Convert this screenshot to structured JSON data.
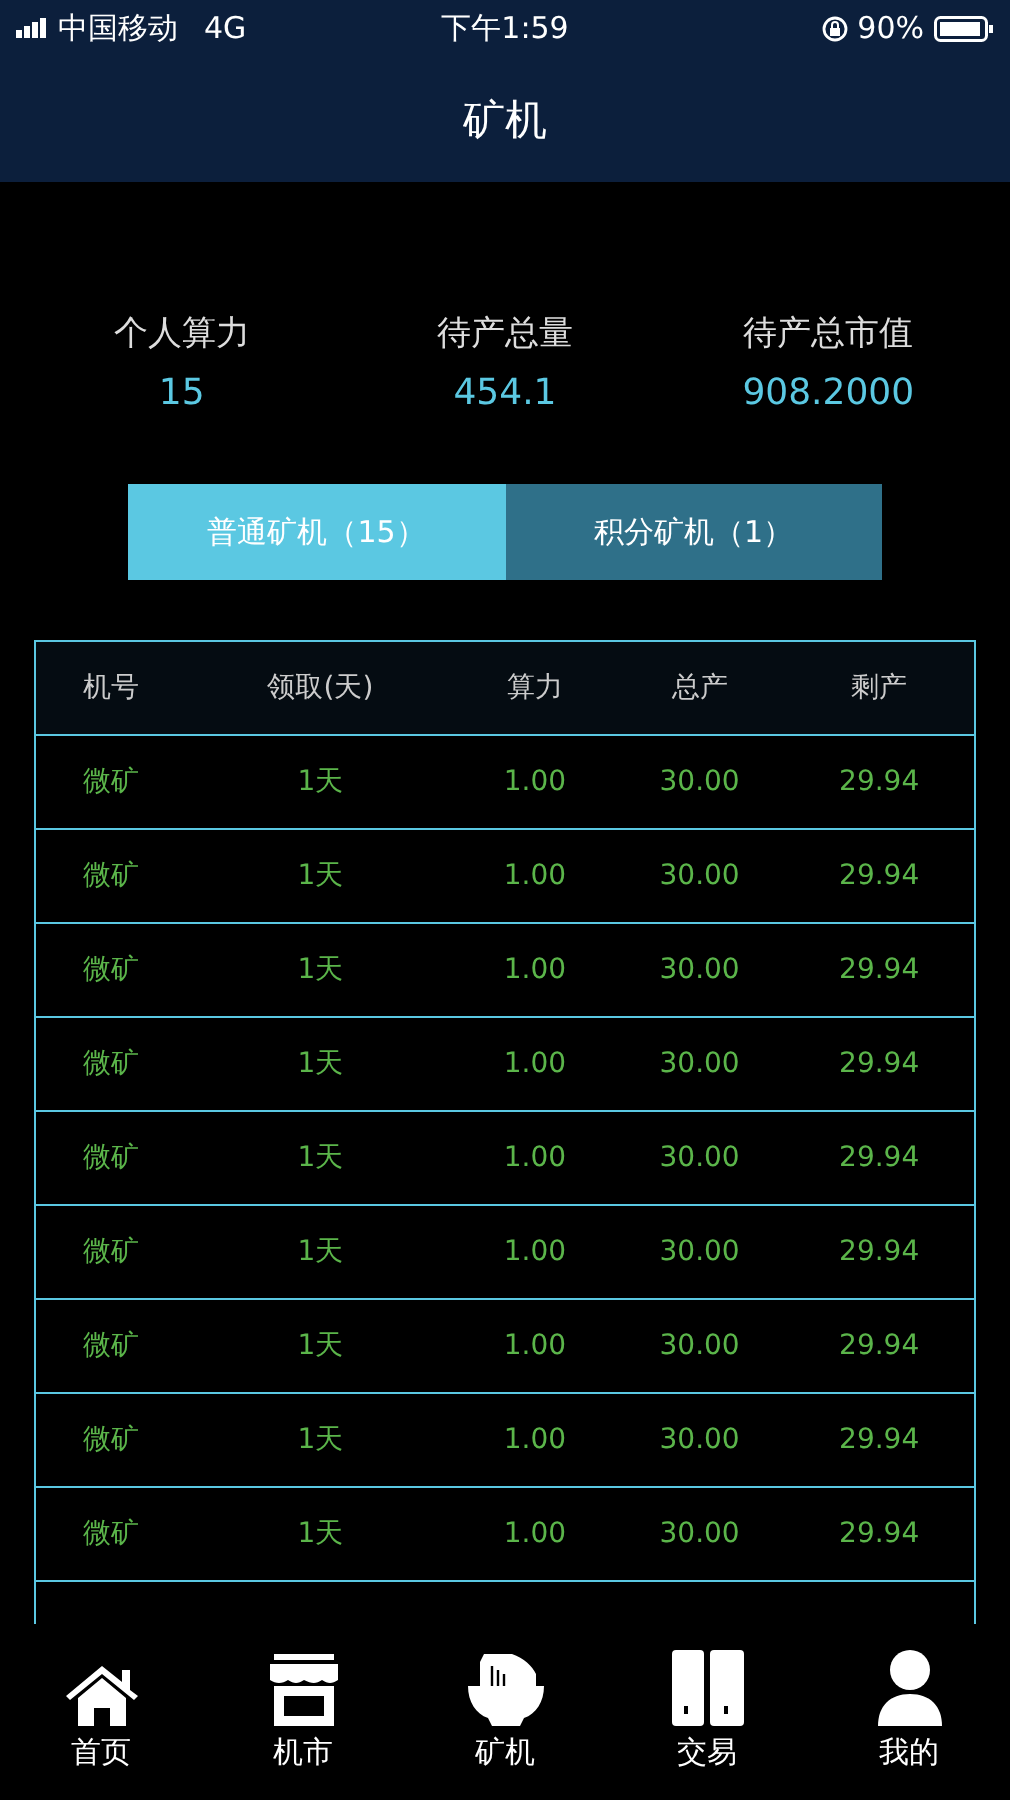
{
  "status_bar": {
    "carrier": "中国移动",
    "network": "4G",
    "time": "下午1:59",
    "battery": "90%"
  },
  "title": "矿机",
  "stats": [
    {
      "label": "个人算力",
      "value": "15"
    },
    {
      "label": "待产总量",
      "value": "454.1"
    },
    {
      "label": "待产总市值",
      "value": "908.2000"
    }
  ],
  "tabs": [
    {
      "label": "普通矿机（15）",
      "selected": true
    },
    {
      "label": "积分矿机（1）",
      "selected": false
    }
  ],
  "table": {
    "columns": [
      "机号",
      "领取(天)",
      "算力",
      "总产",
      "剩产"
    ],
    "rows": [
      [
        "微矿",
        "1天",
        "1.00",
        "30.00",
        "29.94"
      ],
      [
        "微矿",
        "1天",
        "1.00",
        "30.00",
        "29.94"
      ],
      [
        "微矿",
        "1天",
        "1.00",
        "30.00",
        "29.94"
      ],
      [
        "微矿",
        "1天",
        "1.00",
        "30.00",
        "29.94"
      ],
      [
        "微矿",
        "1天",
        "1.00",
        "30.00",
        "29.94"
      ],
      [
        "微矿",
        "1天",
        "1.00",
        "30.00",
        "29.94"
      ],
      [
        "微矿",
        "1天",
        "1.00",
        "30.00",
        "29.94"
      ],
      [
        "微矿",
        "1天",
        "1.00",
        "30.00",
        "29.94"
      ],
      [
        "微矿",
        "1天",
        "1.00",
        "30.00",
        "29.94"
      ]
    ]
  },
  "nav": [
    {
      "label": "首页",
      "kind": "home"
    },
    {
      "label": "机市",
      "kind": "shop"
    },
    {
      "label": "矿机",
      "kind": "miner"
    },
    {
      "label": "交易",
      "kind": "trade"
    },
    {
      "label": "我的",
      "kind": "user"
    }
  ]
}
